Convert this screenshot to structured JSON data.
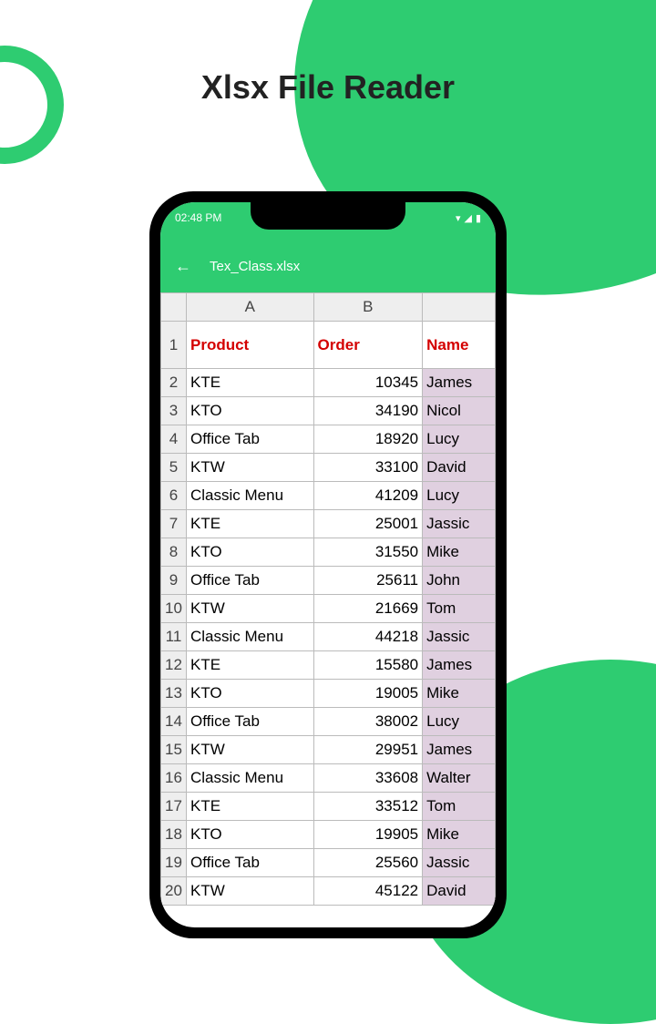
{
  "page": {
    "title": "Xlsx File Reader"
  },
  "status": {
    "time": "02:48 PM"
  },
  "appbar": {
    "filename": "Tex_Class.xlsx"
  },
  "cols": {
    "a": "A",
    "b": "B"
  },
  "headers": {
    "product": "Product",
    "order": "Order",
    "name": "Name"
  },
  "rows": [
    {
      "n": "1",
      "a": "",
      "b": "",
      "c": ""
    },
    {
      "n": "2",
      "a": "KTE",
      "b": "10345",
      "c": "James"
    },
    {
      "n": "3",
      "a": "KTO",
      "b": "34190",
      "c": "Nicol"
    },
    {
      "n": "4",
      "a": "Office Tab",
      "b": "18920",
      "c": "Lucy"
    },
    {
      "n": "5",
      "a": "KTW",
      "b": "33100",
      "c": "David"
    },
    {
      "n": "6",
      "a": "Classic Menu",
      "b": "41209",
      "c": "Lucy"
    },
    {
      "n": "7",
      "a": "KTE",
      "b": "25001",
      "c": "Jassic"
    },
    {
      "n": "8",
      "a": "KTO",
      "b": "31550",
      "c": "Mike"
    },
    {
      "n": "9",
      "a": "Office Tab",
      "b": "25611",
      "c": "John"
    },
    {
      "n": "10",
      "a": "KTW",
      "b": "21669",
      "c": "Tom"
    },
    {
      "n": "11",
      "a": "Classic Menu",
      "b": "44218",
      "c": "Jassic"
    },
    {
      "n": "12",
      "a": "KTE",
      "b": "15580",
      "c": "James"
    },
    {
      "n": "13",
      "a": "KTO",
      "b": "19005",
      "c": "Mike"
    },
    {
      "n": "14",
      "a": "Office Tab",
      "b": "38002",
      "c": "Lucy"
    },
    {
      "n": "15",
      "a": "KTW",
      "b": "29951",
      "c": "James"
    },
    {
      "n": "16",
      "a": "Classic Menu",
      "b": "33608",
      "c": "Walter"
    },
    {
      "n": "17",
      "a": "KTE",
      "b": "33512",
      "c": "Tom"
    },
    {
      "n": "18",
      "a": "KTO",
      "b": "19905",
      "c": "Mike"
    },
    {
      "n": "19",
      "a": "Office Tab",
      "b": "25560",
      "c": "Jassic"
    },
    {
      "n": "20",
      "a": "KTW",
      "b": "45122",
      "c": "David"
    }
  ]
}
